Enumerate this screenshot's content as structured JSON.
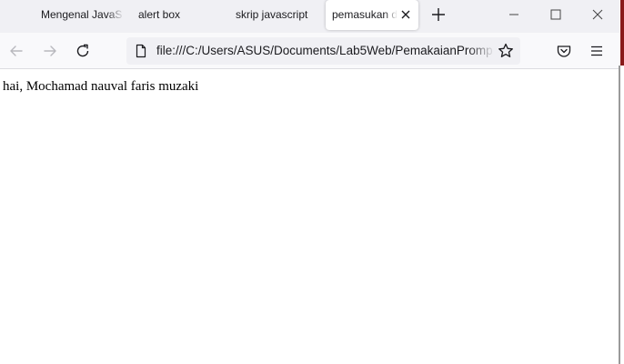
{
  "tabs": [
    {
      "label": "Mengenal JavaS",
      "active": false,
      "faded": true
    },
    {
      "label": "alert box",
      "active": false,
      "faded": false
    },
    {
      "label": "skrip javascript",
      "active": false,
      "faded": false
    },
    {
      "label": "pemasukan d",
      "active": true,
      "faded": true
    }
  ],
  "toolbar": {
    "url": "file:///C:/Users/ASUS/Documents/Lab5Web/PemakaianPromp"
  },
  "page": {
    "text": "hai, Mochamad nauval faris muzaki"
  },
  "icons": {
    "tab_close": "close-icon",
    "new_tab": "plus-icon",
    "minimize": "minimize-icon",
    "maximize": "maximize-icon",
    "close_window": "close-icon",
    "back": "arrow-left-icon",
    "forward": "arrow-right-icon",
    "reload": "reload-icon",
    "page": "page-icon",
    "bookmark": "star-icon",
    "pocket": "pocket-icon",
    "menu": "hamburger-icon"
  },
  "colors": {
    "tabstrip_bg": "#f0f0f4",
    "toolbar_bg": "#f9f9fb",
    "urlbar_bg": "#f0f0f4",
    "edge_accent": "#8a1a1a"
  }
}
